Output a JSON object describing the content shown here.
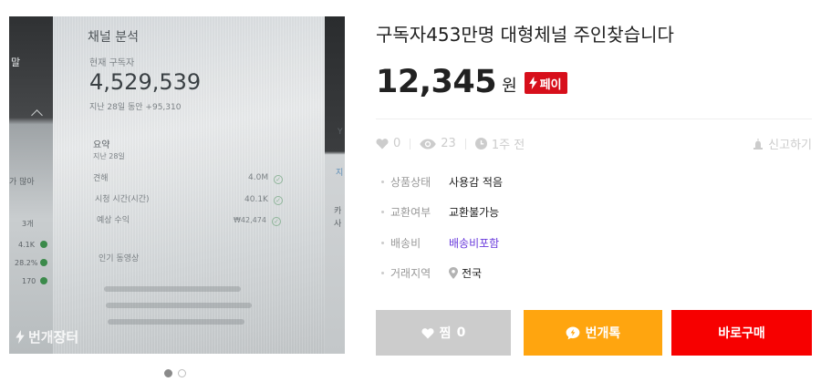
{
  "product": {
    "title": "구독자453만명 대형체널 주인찾습니다",
    "price": "12,345",
    "currency": "원",
    "pay_badge": "페이",
    "stats": {
      "likes": "0",
      "views": "23",
      "time": "1주 전"
    },
    "report_label": "신고하기",
    "details": [
      {
        "label": "상품상태",
        "value": "사용감 적음"
      },
      {
        "label": "교환여부",
        "value": "교환불가능"
      },
      {
        "label": "배송비",
        "value": "배송비포함"
      },
      {
        "label": "거래지역",
        "value": "전국"
      }
    ]
  },
  "photo": {
    "heading": "채널 분석",
    "subscriber_label": "현재 구독자",
    "subscriber_count": "4,529,539",
    "subscriber_change": "지난 28일 동안 +95,310",
    "summary_label": "요약",
    "summary_period": "지난 28일",
    "rows": [
      {
        "label": "견해",
        "value": "4.0M"
      },
      {
        "label": "시청 시간(시간)",
        "value": "40.1K"
      },
      {
        "label": "예상 수익",
        "value": "₩42,474"
      }
    ],
    "popular_label": "인기 동영상",
    "side_texts": [
      "말",
      "가 많아",
      "3개",
      "4.1K",
      "28.2%",
      "170"
    ],
    "right_texts": [
      "Y",
      "지",
      "카",
      "사"
    ],
    "watermark": "번개장터"
  },
  "gallery": {
    "total": 2,
    "active": 1
  },
  "actions": {
    "like_label": "찜",
    "like_count": "0",
    "chat_label": "번개톡",
    "buy_label": "바로구매"
  },
  "colors": {
    "brand_red": "#d70f1b",
    "buy_red": "#f70000",
    "chat_orange": "#ffa50f",
    "like_gray": "#cccccc",
    "link_purple": "#6a3bdc"
  }
}
